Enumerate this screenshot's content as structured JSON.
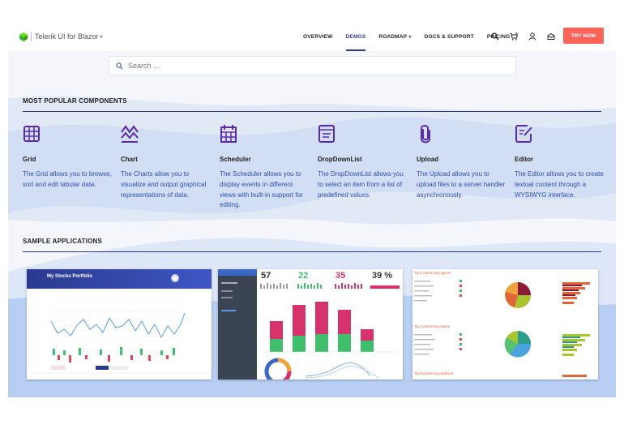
{
  "header": {
    "brand": "Telerik UI for Blazor",
    "nav": [
      {
        "label": "OVERVIEW",
        "active": false
      },
      {
        "label": "DEMOS",
        "active": true
      },
      {
        "label": "ROADMAP",
        "active": false
      },
      {
        "label": "DOCS & SUPPORT",
        "active": false
      },
      {
        "label": "PRICING",
        "active": false
      }
    ],
    "icons": [
      "search-icon",
      "cart-icon",
      "user-icon",
      "mail-icon"
    ],
    "try_label": "TRY NOW",
    "accent": "#ff6358",
    "nav_active_color": "#2a3a94"
  },
  "search": {
    "placeholder": "Search ..."
  },
  "popular": {
    "title": "MOST POPULAR COMPONENTS",
    "components": [
      {
        "name": "Grid",
        "desc": "The Grid allows you to browse, sort and edit tabular data.",
        "icon": "grid-icon"
      },
      {
        "name": "Chart",
        "desc": "The Charts allow you to visualize and output graphical representations of data.",
        "icon": "chart-icon"
      },
      {
        "name": "Scheduler",
        "desc": "The Scheduler allows you to display events in different views with built-in support for editing.",
        "icon": "scheduler-icon"
      },
      {
        "name": "DropDownList",
        "desc": "The DropDownList allows you to select an item from a list of predefined values.",
        "icon": "dropdownlist-icon"
      },
      {
        "name": "Upload",
        "desc": "The Upload allows you to upload files to a server handler asynchronously.",
        "icon": "upload-icon"
      },
      {
        "name": "Editor",
        "desc": "The Editor allows you to create textual content through a WYSIWYG interface.",
        "icon": "editor-icon"
      }
    ],
    "icon_color": "#5b2aa8"
  },
  "samples": {
    "title": "SAMPLE APPLICATIONS",
    "stocks": {
      "title": "My Stocks Portfolio"
    },
    "dashboard": {
      "stats": [
        "57",
        "22",
        "35",
        "39 %"
      ]
    },
    "sales": {
      "sections": [
        "Top 5 performing agents",
        "Top 5 performing stores",
        "Top 5 performing products"
      ]
    }
  }
}
